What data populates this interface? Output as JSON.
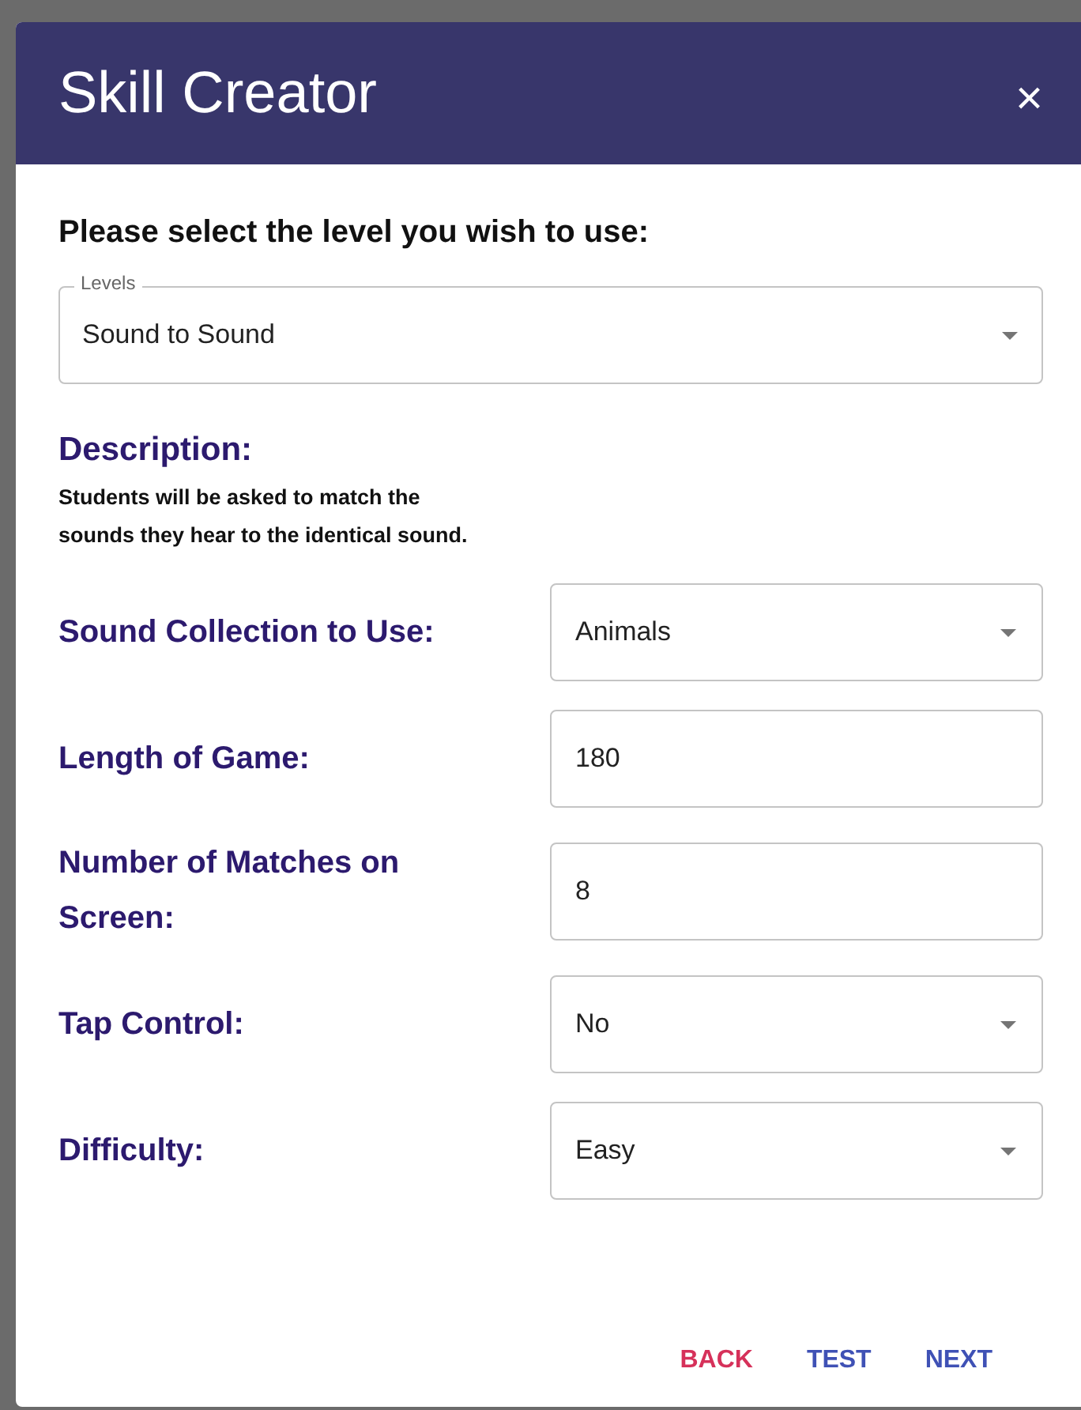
{
  "dialog": {
    "title": "Skill Creator",
    "close": "×"
  },
  "prompt": "Please select the level you wish to use:",
  "level_select": {
    "label": "Levels",
    "value": "Sound to Sound"
  },
  "description": {
    "heading": "Description:",
    "text": "Students will be asked to match the sounds they hear to the identical sound."
  },
  "settings": [
    {
      "label": "Sound Collection to Use:",
      "kind": "select",
      "value": "Animals"
    },
    {
      "label": "Length of Game:",
      "kind": "text",
      "value": "180"
    },
    {
      "label": "Number of Matches on Screen:",
      "kind": "text",
      "value": "8"
    },
    {
      "label": "Tap Control:",
      "kind": "select",
      "value": "No"
    },
    {
      "label": "Difficulty:",
      "kind": "select",
      "value": "Easy"
    }
  ],
  "buttons": [
    {
      "label": "BACK",
      "kind": "cancel"
    },
    {
      "label": "TEST",
      "kind": "action"
    },
    {
      "label": "NEXT",
      "kind": "action"
    }
  ]
}
